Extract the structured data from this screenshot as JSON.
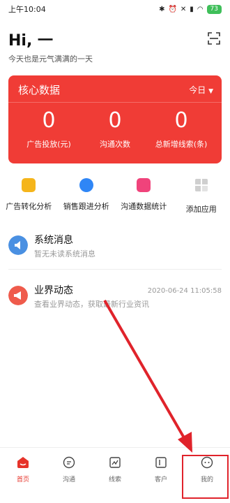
{
  "status_bar": {
    "time": "上午10:04",
    "battery": "73"
  },
  "header": {
    "greeting": "Hi, 一",
    "subtitle": "今天也是元气满满的一天",
    "scan_icon": "scan-icon"
  },
  "core_card": {
    "title": "核心数据",
    "period": "今日",
    "metrics": [
      {
        "value": "0",
        "label": "广告投放(元)"
      },
      {
        "value": "0",
        "label": "沟通次数"
      },
      {
        "value": "0",
        "label": "总新增线索(条)"
      }
    ],
    "color": "#f03c36"
  },
  "apps": [
    {
      "label": "广告转化分析",
      "color": "#f5b51b"
    },
    {
      "label": "销售跟进分析",
      "color": "#2f86f6"
    },
    {
      "label": "沟通数据统计",
      "color": "#f0437b"
    },
    {
      "label": "添加应用",
      "color": "#c9c9c9"
    }
  ],
  "messages": [
    {
      "title": "系统消息",
      "subtitle": "暂无未读系统消息",
      "time": "",
      "color": "#4a90e2"
    },
    {
      "title": "业界动态",
      "subtitle": "查看业界动态，获取最新行业资讯",
      "time": "2020-06-24 11:05:58",
      "color": "#ef5b4c"
    }
  ],
  "tabs": [
    {
      "label": "首页",
      "icon": "home-icon",
      "active": true
    },
    {
      "label": "沟通",
      "icon": "chat-icon"
    },
    {
      "label": "线索",
      "icon": "leads-icon"
    },
    {
      "label": "客户",
      "icon": "customer-icon"
    },
    {
      "label": "我的",
      "icon": "profile-icon"
    }
  ],
  "accent_color": "#e6332a"
}
